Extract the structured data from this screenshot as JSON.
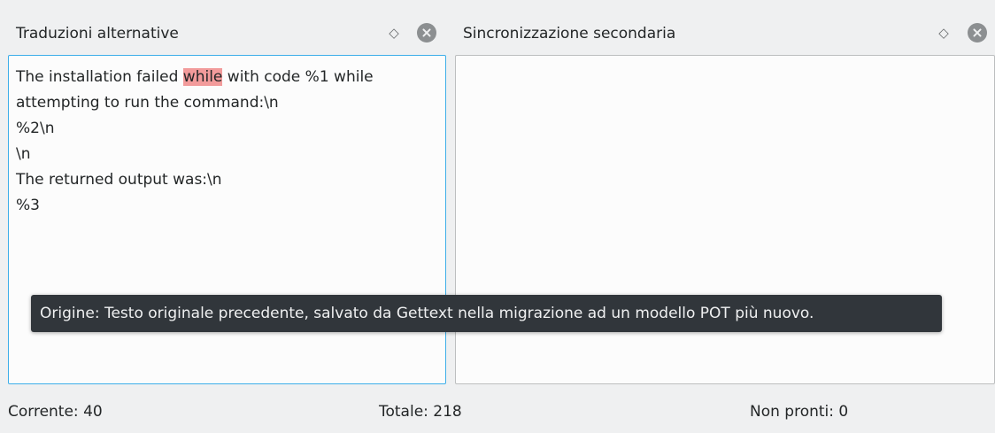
{
  "panels": {
    "left": {
      "title": "Traduzioni alternative",
      "text_before": "The installation failed ",
      "highlight": "while",
      "text_after": " with code %1 while\nattempting to run the command:\\n\n%2\\n\n\\n\nThe returned output was:\\n\n%3",
      "float_icon": "float-diamond-icon",
      "close_icon": "close-circle-icon"
    },
    "right": {
      "title": "Sincronizzazione secondaria",
      "float_icon": "float-diamond-icon",
      "close_icon": "close-circle-icon"
    }
  },
  "tooltip": {
    "text": "Origine: Testo originale precedente, salvato da Gettext nella migrazione ad un modello POT più nuovo."
  },
  "status_bar": {
    "current": "Corrente: 40",
    "total": "Totale: 218",
    "not_ready": "Non pronti: 0"
  },
  "colors": {
    "highlight": "#f29b9b",
    "focus_border": "#3daee9",
    "tooltip_bg": "#31363b",
    "window_bg": "#eff0f1"
  },
  "glyphs": {
    "float": "◇"
  }
}
